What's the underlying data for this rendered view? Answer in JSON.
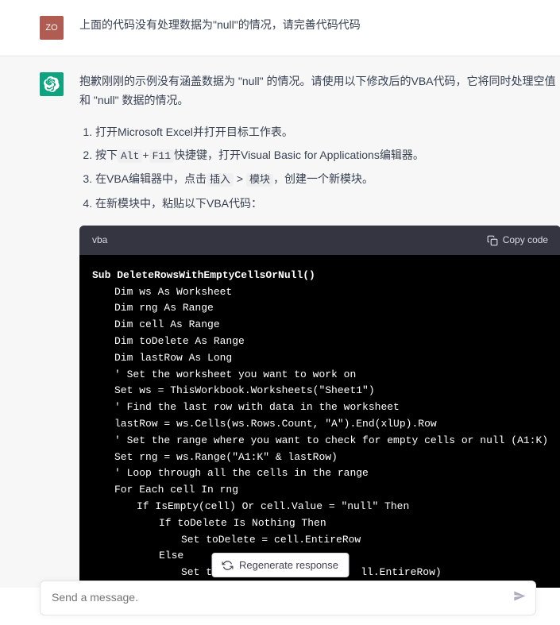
{
  "user": {
    "avatar_text": "ZO",
    "message": "上面的代码没有处理数据为\"null\"的情况，请完善代码代码"
  },
  "assistant": {
    "intro": "抱歉刚刚的示例没有涵盖数据为 \"null\" 的情况。请使用以下修改后的VBA代码，它将同时处理空值和 \"null\" 数据的情况。",
    "steps": {
      "s1_a": "打开Microsoft Excel并打开目标工作表。",
      "s2_a": "按下",
      "s2_code1": "Alt",
      "s2_b": "+",
      "s2_code2": "F11",
      "s2_c": "快捷键，打开Visual Basic for Applications编辑器。",
      "s3_a": "在VBA编辑器中，点击",
      "s3_code1": "插入",
      "s3_b": " > ",
      "s3_code2": "模块",
      "s3_c": "，创建一个新模块。",
      "s4_a": "在新模块中，粘贴以下VBA代码："
    },
    "code_lang": "vba",
    "copy_label": "Copy code",
    "code": {
      "l1": "Sub DeleteRowsWithEmptyCellsOrNull()",
      "l2": "Dim ws As Worksheet",
      "l3": "Dim rng As Range",
      "l4": "Dim cell As Range",
      "l5": "Dim toDelete As Range",
      "l6": "Dim lastRow As Long",
      "l7": "",
      "l8": "' Set the worksheet you want to work on",
      "l9": "Set ws = ThisWorkbook.Worksheets(\"Sheet1\")",
      "l10": "",
      "l11": "' Find the last row with data in the worksheet",
      "l12": "lastRow = ws.Cells(ws.Rows.Count, \"A\").End(xlUp).Row",
      "l13": "",
      "l14": "' Set the range where you want to check for empty cells or null (A1:K)",
      "l15": "Set rng = ws.Range(\"A1:K\" & lastRow)",
      "l16": "",
      "l17": "' Loop through all the cells in the range",
      "l18": "For Each cell In rng",
      "l19": "If IsEmpty(cell) Or cell.Value = \"null\" Then",
      "l20": "If toDelete Is Nothing Then",
      "l21": "Set toDelete = cell.EntireRow",
      "l22": "Else",
      "l23a": "Set toDele",
      "l23b": "ll.EntireRow)"
    }
  },
  "regen_label": "Regenerate response",
  "input_placeholder": "Send a message."
}
